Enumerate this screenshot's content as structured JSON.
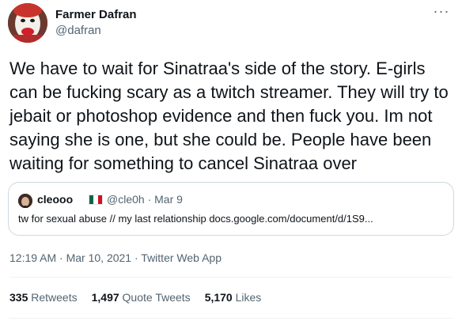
{
  "author": {
    "name": "Farmer Dafran",
    "handle": "@dafran"
  },
  "more_icon": "ellipsis-icon",
  "tweet": {
    "text": "We have to wait for Sinatraa's side of the story. E-girls can be fucking scary as a twitch streamer. They will try to jebait or photoshop evidence and then fuck you. Im not saying she is one, but she could be. People have been waiting for something to cancel Sinatraa over"
  },
  "quote": {
    "name": "cleooo",
    "flag": "mexico-flag",
    "handle_date": "@cle0h · Mar 9",
    "text": "tw for sexual abuse // my last relationship docs.google.com/document/d/1S9..."
  },
  "meta": {
    "time": "12:19 AM · Mar 10, 2021",
    "separator": " · ",
    "source": "Twitter Web App"
  },
  "stats": {
    "retweets_count": "335",
    "retweets_label": "Retweets",
    "quotes_count": "1,497",
    "quotes_label": "Quote Tweets",
    "likes_count": "5,170",
    "likes_label": "Likes"
  },
  "colors": {
    "text": "#0f1419",
    "secondary": "#536471",
    "border": "#cfd9de"
  }
}
